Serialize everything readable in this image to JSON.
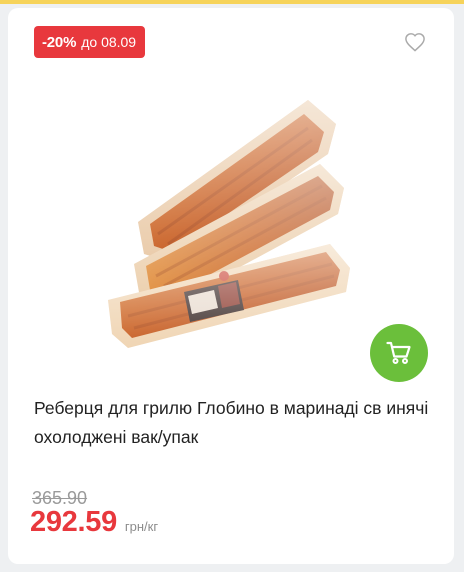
{
  "product_card": {
    "discount_badge": {
      "percent": "-20%",
      "until": "до 08.09",
      "color": "#e8383d"
    },
    "favorite_icon": "heart-outline-icon",
    "image": {
      "alt": "Реберця для грилю Глобино в маринаді св инячі охолоджені вак/упак"
    },
    "cart_button": {
      "icon": "shopping-cart-icon",
      "color": "#6bbf3b"
    },
    "title": "Реберця для грилю Глобино в маринаді св инячі охолоджені вак/упак",
    "old_price": "365.90",
    "price": "292.59",
    "unit": "грн/кг",
    "accent_color": "#e8383d"
  }
}
